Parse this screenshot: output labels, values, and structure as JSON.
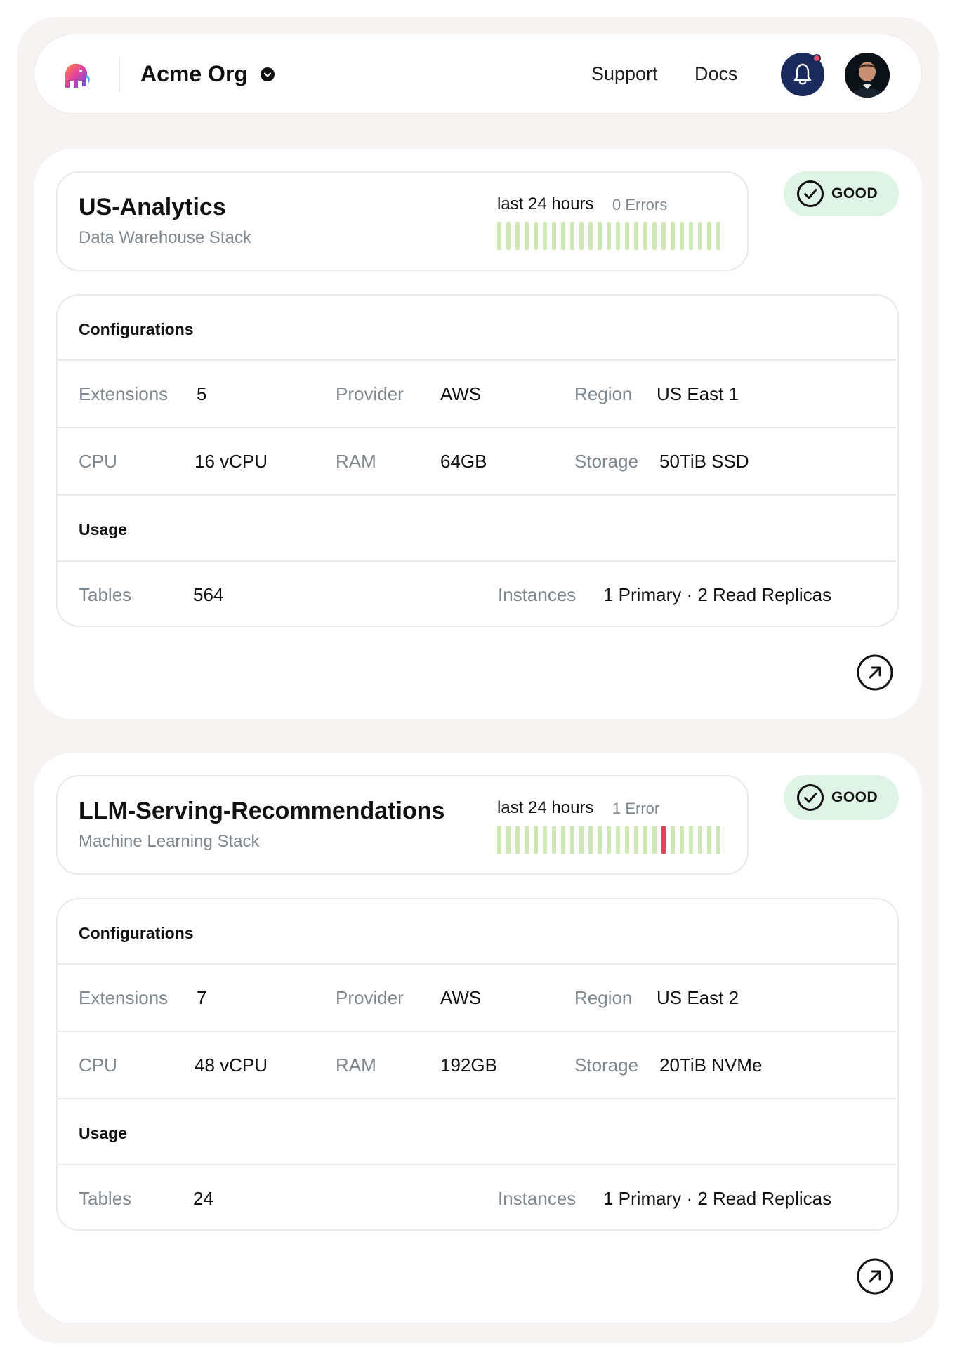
{
  "header": {
    "org_name": "Acme Org",
    "nav": {
      "support": "Support",
      "docs": "Docs"
    },
    "icons": {
      "logo": "elephant-logo",
      "org_menu": "chevron-down-icon",
      "notifications": "bell-icon",
      "avatar": "user-avatar"
    },
    "colors": {
      "bell_bg": "#1b2a5c",
      "notification_dot": "#ec4a63"
    }
  },
  "services": [
    {
      "name": "US-Analytics",
      "subtitle": "Data Warehouse Stack",
      "range_label": "last 24 hours",
      "errors_label": "0 Errors",
      "bars": [
        0,
        0,
        0,
        0,
        0,
        0,
        0,
        0,
        0,
        0,
        0,
        0,
        0,
        0,
        0,
        0,
        0,
        0,
        0,
        0,
        0,
        0,
        0,
        0,
        0
      ],
      "status": "GOOD",
      "configurations_title": "Configurations",
      "config": {
        "extensions_label": "Extensions",
        "extensions": "5",
        "provider_label": "Provider",
        "provider": "AWS",
        "region_label": "Region",
        "region": "US East 1",
        "cpu_label": "CPU",
        "cpu": "16 vCPU",
        "ram_label": "RAM",
        "ram": "64GB",
        "storage_label": "Storage",
        "storage": "50TiB SSD"
      },
      "usage_title": "Usage",
      "usage": {
        "tables_label": "Tables",
        "tables": "564",
        "instances_label": "Instances",
        "instances": "1 Primary · 2 Read Replicas"
      }
    },
    {
      "name": "LLM-Serving-Recommendations",
      "subtitle": "Machine Learning Stack",
      "range_label": "last 24 hours",
      "errors_label": "1 Error",
      "bars": [
        0,
        0,
        0,
        0,
        0,
        0,
        0,
        0,
        0,
        0,
        0,
        0,
        0,
        0,
        0,
        0,
        0,
        0,
        1,
        0,
        0,
        0,
        0,
        0,
        0
      ],
      "status": "GOOD",
      "configurations_title": "Configurations",
      "config": {
        "extensions_label": "Extensions",
        "extensions": "7",
        "provider_label": "Provider",
        "provider": "AWS",
        "region_label": "Region",
        "region": "US East 2",
        "cpu_label": "CPU",
        "cpu": "48 vCPU",
        "ram_label": "RAM",
        "ram": "192GB",
        "storage_label": "Storage",
        "storage": "20TiB NVMe"
      },
      "usage_title": "Usage",
      "usage": {
        "tables_label": "Tables",
        "tables": "24",
        "instances_label": "Instances",
        "instances": "1 Primary · 2 Read Replicas"
      }
    }
  ],
  "colors": {
    "background": "#f6f3f2",
    "bar_ok": "#cfe7b5",
    "bar_error": "#e3445c",
    "badge_bg": "#dff3e6",
    "muted_text": "#80888f"
  }
}
